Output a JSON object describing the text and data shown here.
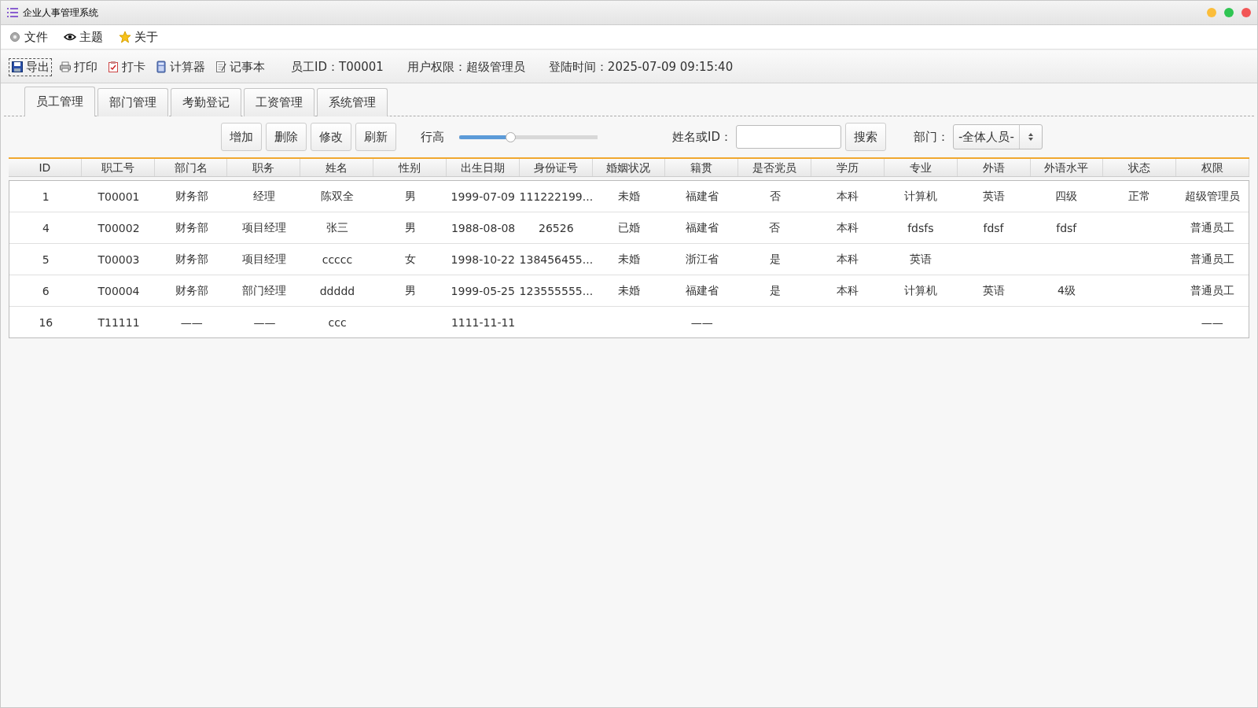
{
  "window": {
    "title": "企业人事管理系统",
    "controls": [
      {
        "color": "#fbbd3a"
      },
      {
        "color": "#2fc552"
      },
      {
        "color": "#f25656"
      }
    ]
  },
  "menu": [
    {
      "label": "文件"
    },
    {
      "label": "主题"
    },
    {
      "label": "关于"
    }
  ],
  "toolbar": {
    "buttons": [
      {
        "label": "导出",
        "focused": true
      },
      {
        "label": "打印",
        "focused": false
      },
      {
        "label": "打卡",
        "focused": false
      },
      {
        "label": "计算器",
        "focused": false
      },
      {
        "label": "记事本",
        "focused": false
      }
    ],
    "info": [
      "员工ID：T00001",
      "用户权限：超级管理员",
      "登陆时间：2025-07-09 09:15:40"
    ]
  },
  "tabs": [
    {
      "label": "员工管理",
      "selected": true
    },
    {
      "label": "部门管理",
      "selected": false
    },
    {
      "label": "考勤登记",
      "selected": false
    },
    {
      "label": "工资管理",
      "selected": false
    },
    {
      "label": "系统管理",
      "selected": false
    }
  ],
  "actions": [
    "增加",
    "删除",
    "修改",
    "刷新"
  ],
  "row_height": {
    "label": "行高",
    "level": 0.37
  },
  "search": {
    "label": "姓名或ID：",
    "button": "搜索"
  },
  "department": {
    "label": "部门：",
    "value": "-全体人员-"
  },
  "table": {
    "columns": [
      "ID",
      "职工号",
      "部门名",
      "职务",
      "姓名",
      "性别",
      "出生日期",
      "身份证号",
      "婚姻状况",
      "籍贯",
      "是否党员",
      "学历",
      "专业",
      "外语",
      "外语水平",
      "状态",
      "权限"
    ],
    "rows": [
      {
        "cells": [
          "1",
          "T00001",
          "财务部",
          "经理",
          "陈双全",
          "男",
          "1999-07-09",
          "111222199...",
          "未婚",
          "福建省",
          "否",
          "本科",
          "计算机",
          "英语",
          "四级",
          "正常",
          "超级管理员"
        ]
      },
      {
        "cells": [
          "4",
          "T00002",
          "财务部",
          "项目经理",
          "张三",
          "男",
          "1988-08-08",
          "26526",
          "已婚",
          "福建省",
          "否",
          "本科",
          "fdsfs",
          "fdsf",
          "fdsf",
          null,
          "普通员工"
        ]
      },
      {
        "cells": [
          "5",
          "T00003",
          "财务部",
          "项目经理",
          "ccccc",
          "女",
          "1998-10-22",
          "138456455...",
          "未婚",
          "浙江省",
          "是",
          "本科",
          "英语",
          null,
          null,
          null,
          "普通员工"
        ]
      },
      {
        "cells": [
          "6",
          "T00004",
          "财务部",
          "部门经理",
          "ddddd",
          "男",
          "1999-05-25",
          "123555555...",
          "未婚",
          "福建省",
          "是",
          "本科",
          "计算机",
          "英语",
          "4级",
          null,
          "普通员工"
        ]
      },
      {
        "cells": [
          "16",
          "T11111",
          "——",
          "——",
          "ccc",
          null,
          "1111-11-11",
          null,
          null,
          "——",
          null,
          null,
          null,
          null,
          null,
          null,
          "——"
        ]
      }
    ]
  }
}
